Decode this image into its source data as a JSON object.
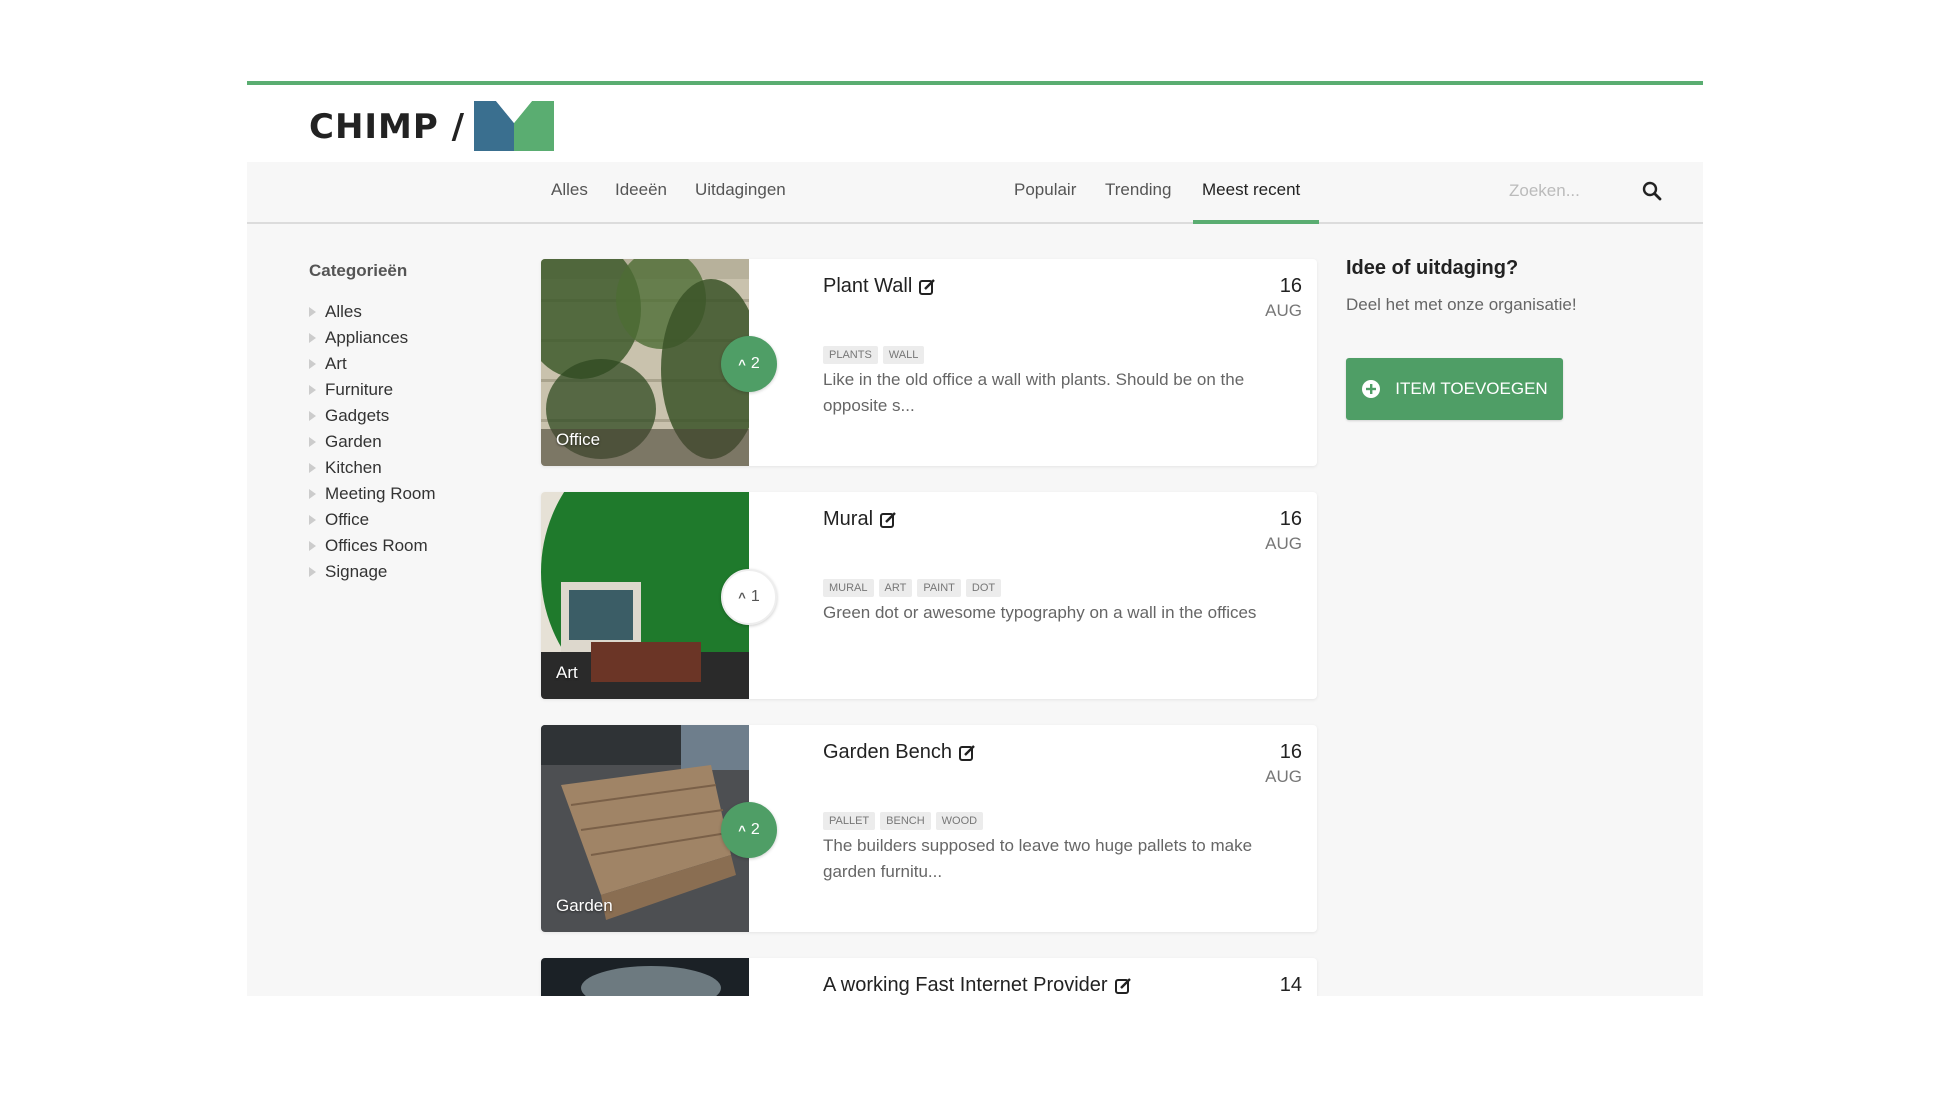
{
  "brand": {
    "logo_text": "CHIMP /"
  },
  "nav": {
    "left": [
      "Alles",
      "Ideeën",
      "Uitdagingen"
    ],
    "sort": [
      "Populair",
      "Trending",
      "Meest recent"
    ],
    "search_placeholder": "Zoeken..."
  },
  "sidebar": {
    "title": "Categorieën",
    "items": [
      "Alles",
      "Appliances",
      "Art",
      "Furniture",
      "Gadgets",
      "Garden",
      "Kitchen",
      "Meeting Room",
      "Office",
      "Offices Room",
      "Signage"
    ]
  },
  "cards": [
    {
      "title": "Plant Wall",
      "category": "Office",
      "votes": "2",
      "voted": true,
      "day": "16",
      "month": "AUG",
      "tags": [
        "PLANTS",
        "WALL"
      ],
      "description": "Like in the old office a wall with plants. Should be on the opposite s..."
    },
    {
      "title": "Mural",
      "category": "Art",
      "votes": "1",
      "voted": false,
      "day": "16",
      "month": "AUG",
      "tags": [
        "MURAL",
        "ART",
        "PAINT",
        "DOT"
      ],
      "description": "Green dot or awesome typography on a wall in the offices"
    },
    {
      "title": "Garden Bench",
      "category": "Garden",
      "votes": "2",
      "voted": true,
      "day": "16",
      "month": "AUG",
      "tags": [
        "PALLET",
        "BENCH",
        "WOOD"
      ],
      "description": "The builders supposed to leave two huge pallets to make garden furnitu..."
    },
    {
      "title": "A working Fast Internet Provider",
      "day": "14"
    }
  ],
  "aside": {
    "title": "Idee of uitdaging?",
    "text": "Deel het met onze organisatie!",
    "button_label": "ITEM TOEVOEGEN"
  },
  "colors": {
    "accent": "#5aad71",
    "button": "#4f9e66"
  }
}
